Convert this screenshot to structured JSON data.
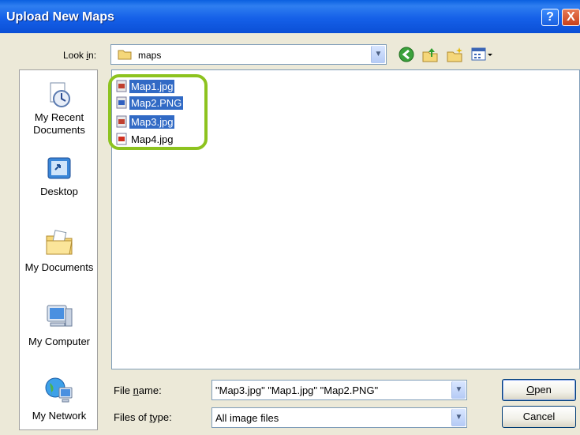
{
  "window": {
    "title": "Upload New Maps",
    "help_label": "?",
    "close_label": "X"
  },
  "lookin": {
    "label_pre": "Look ",
    "label_key": "i",
    "label_post": "n:",
    "value": "maps",
    "arrow": "▼"
  },
  "toolbar": {
    "icons": [
      "back-icon",
      "up-folder-icon",
      "new-folder-icon",
      "view-menu-icon"
    ]
  },
  "places": [
    {
      "label": "My Recent Documents",
      "icon": "recent-documents-icon"
    },
    {
      "label": "Desktop",
      "icon": "desktop-icon"
    },
    {
      "label": "My Documents",
      "icon": "my-documents-icon"
    },
    {
      "label": "My Computer",
      "icon": "my-computer-icon"
    },
    {
      "label": "My Network",
      "icon": "my-network-icon"
    }
  ],
  "files": [
    {
      "name": "Map1.jpg",
      "selected": true
    },
    {
      "name": "Map2.PNG",
      "selected": true
    },
    {
      "name": "Map3.jpg",
      "selected": true
    },
    {
      "name": "Map4.jpg",
      "selected": false
    }
  ],
  "filename": {
    "label_pre": "File ",
    "label_key": "n",
    "label_post": "ame:",
    "value": "\"Map3.jpg\" \"Map1.jpg\" \"Map2.PNG\""
  },
  "filetype": {
    "label_pre": "Files of ",
    "label_key": "t",
    "label_post": "ype:",
    "value": "All image files"
  },
  "buttons": {
    "open_key": "O",
    "open_rest": "pen",
    "cancel": "Cancel"
  },
  "colors": {
    "selection": "#316AC5",
    "highlight": "#8DC31F",
    "titlebar": "#0B4FD6"
  }
}
